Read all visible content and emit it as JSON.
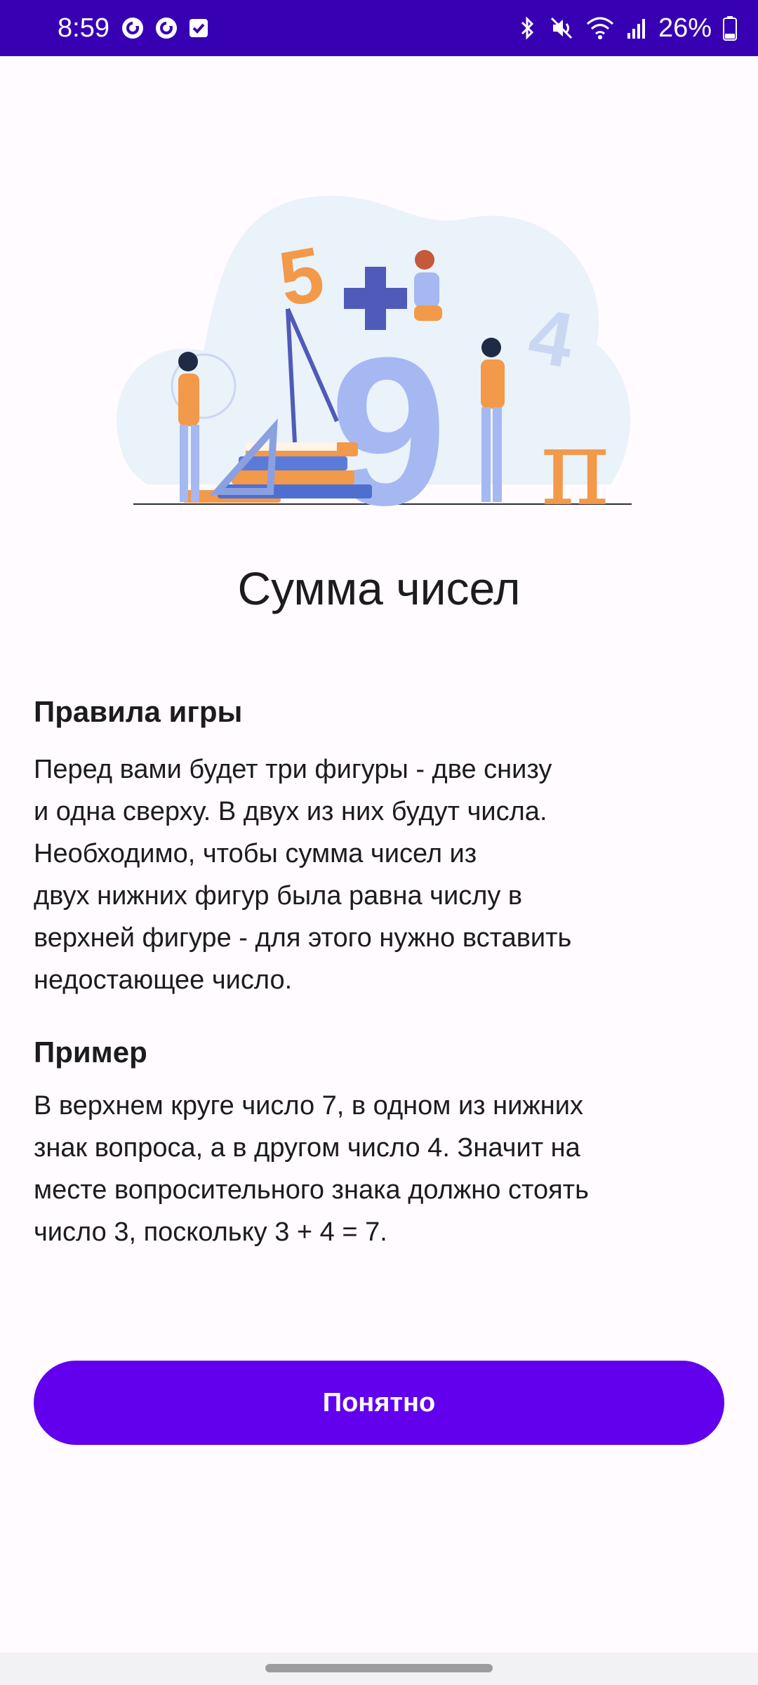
{
  "status_bar": {
    "time": "8:59",
    "battery": "26%",
    "left_icons": [
      "sync-icon",
      "sync-icon",
      "checkbox-icon"
    ],
    "right_icons": [
      "bluetooth-icon",
      "mute-icon",
      "wifi-icon",
      "signal-icon",
      "battery-icon"
    ],
    "background": "#3700B3"
  },
  "illustration": {
    "icon": "math-study-illustration-icon"
  },
  "title": "Сумма чисел",
  "rules": {
    "heading": "Правила игры",
    "text": "Перед вами будет три фигуры - две снизу\nи одна сверху. В двух из них будут числа.\nНеобходимо, чтобы сумма чисел из\nдвух нижних фигур была равна числу в\nверхней фигуре - для этого нужно вставить\nнедостающее число."
  },
  "example": {
    "heading": "Пример",
    "text": "В верхнем круге число 7, в одном из нижних\nзнак вопроса, а в другом число 4. Значит на\nместе вопросительного знака должно стоять\nчисло 3, поскольку 3 + 4 = 7."
  },
  "button": {
    "label": "Понятно",
    "color": "#6200EE"
  },
  "colors": {
    "accent": "#6200EE",
    "status_bar": "#3700B3",
    "background": "#FFFBFE",
    "text": "#1C1B1F"
  }
}
